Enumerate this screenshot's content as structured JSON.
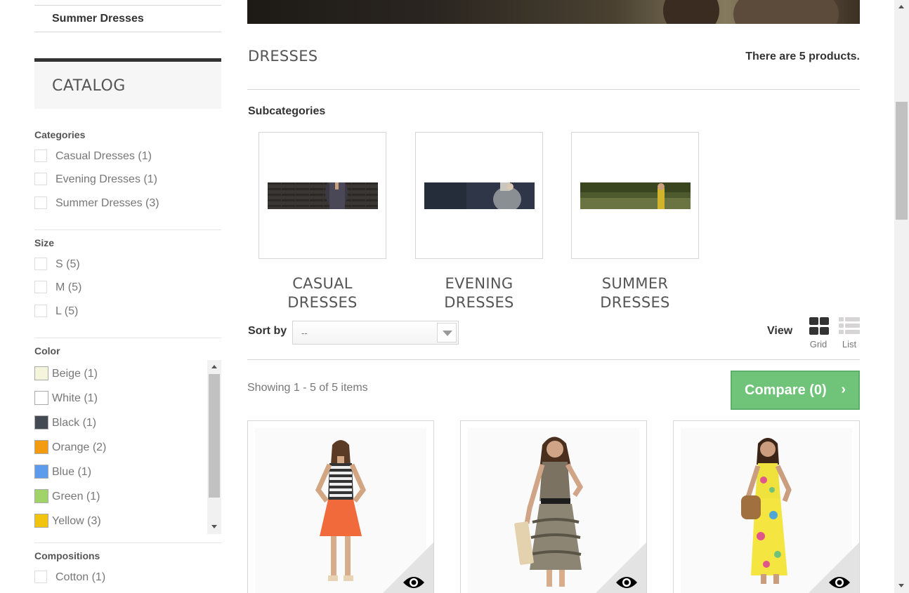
{
  "sidebar": {
    "top_item": "Summer Dresses",
    "catalog_title": "CATALOG",
    "categories": {
      "title": "Categories",
      "items": [
        "Casual Dresses (1)",
        "Evening Dresses (1)",
        "Summer Dresses (3)"
      ]
    },
    "size": {
      "title": "Size",
      "items": [
        "S (5)",
        "M (5)",
        "L (5)"
      ]
    },
    "color": {
      "title": "Color",
      "items": [
        {
          "label": "Beige (1)",
          "color": "#f5f5dc"
        },
        {
          "label": "White (1)",
          "color": "#ffffff"
        },
        {
          "label": "Black (1)",
          "color": "#434a54"
        },
        {
          "label": "Orange (2)",
          "color": "#f39c11"
        },
        {
          "label": "Blue (1)",
          "color": "#5d9cec"
        },
        {
          "label": "Green (1)",
          "color": "#a0d468"
        },
        {
          "label": "Yellow (3)",
          "color": "#f1c40f"
        }
      ]
    },
    "compositions": {
      "title": "Compositions",
      "items": [
        "Cotton (1)"
      ]
    }
  },
  "main": {
    "heading": "DRESSES",
    "product_count": "There are 5 products.",
    "subcategories_title": "Subcategories",
    "subcategories": [
      {
        "line1": "CASUAL",
        "line2": "DRESSES"
      },
      {
        "line1": "EVENING",
        "line2": "DRESSES"
      },
      {
        "line1": "SUMMER",
        "line2": "DRESSES"
      }
    ],
    "sort_label": "Sort by",
    "sort_value": "--",
    "view_label": "View",
    "view_grid": "Grid",
    "view_list": "List",
    "showing": "Showing 1 - 5 of 5 items",
    "compare": "Compare (0)",
    "compare_icon": "chevron-right-icon"
  },
  "colors": {
    "accent_green": "#6fc47a",
    "border": "#d6d4d4"
  }
}
